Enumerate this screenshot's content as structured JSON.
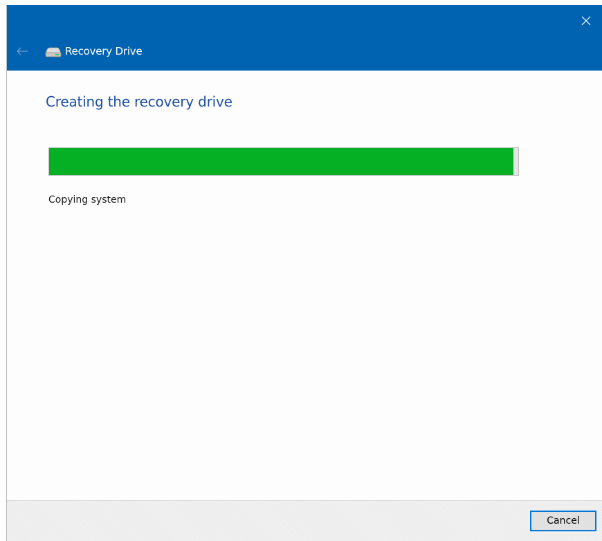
{
  "window": {
    "title": "Recovery Drive",
    "accent_color": "#0063b1",
    "back_icon": "back-arrow-icon",
    "close_icon": "close-icon",
    "app_icon": "drive-icon"
  },
  "main": {
    "heading": "Creating the recovery drive",
    "progress_percent": 99,
    "progress_color": "#06b025",
    "status": "Copying system"
  },
  "footer": {
    "cancel_label": "Cancel"
  }
}
